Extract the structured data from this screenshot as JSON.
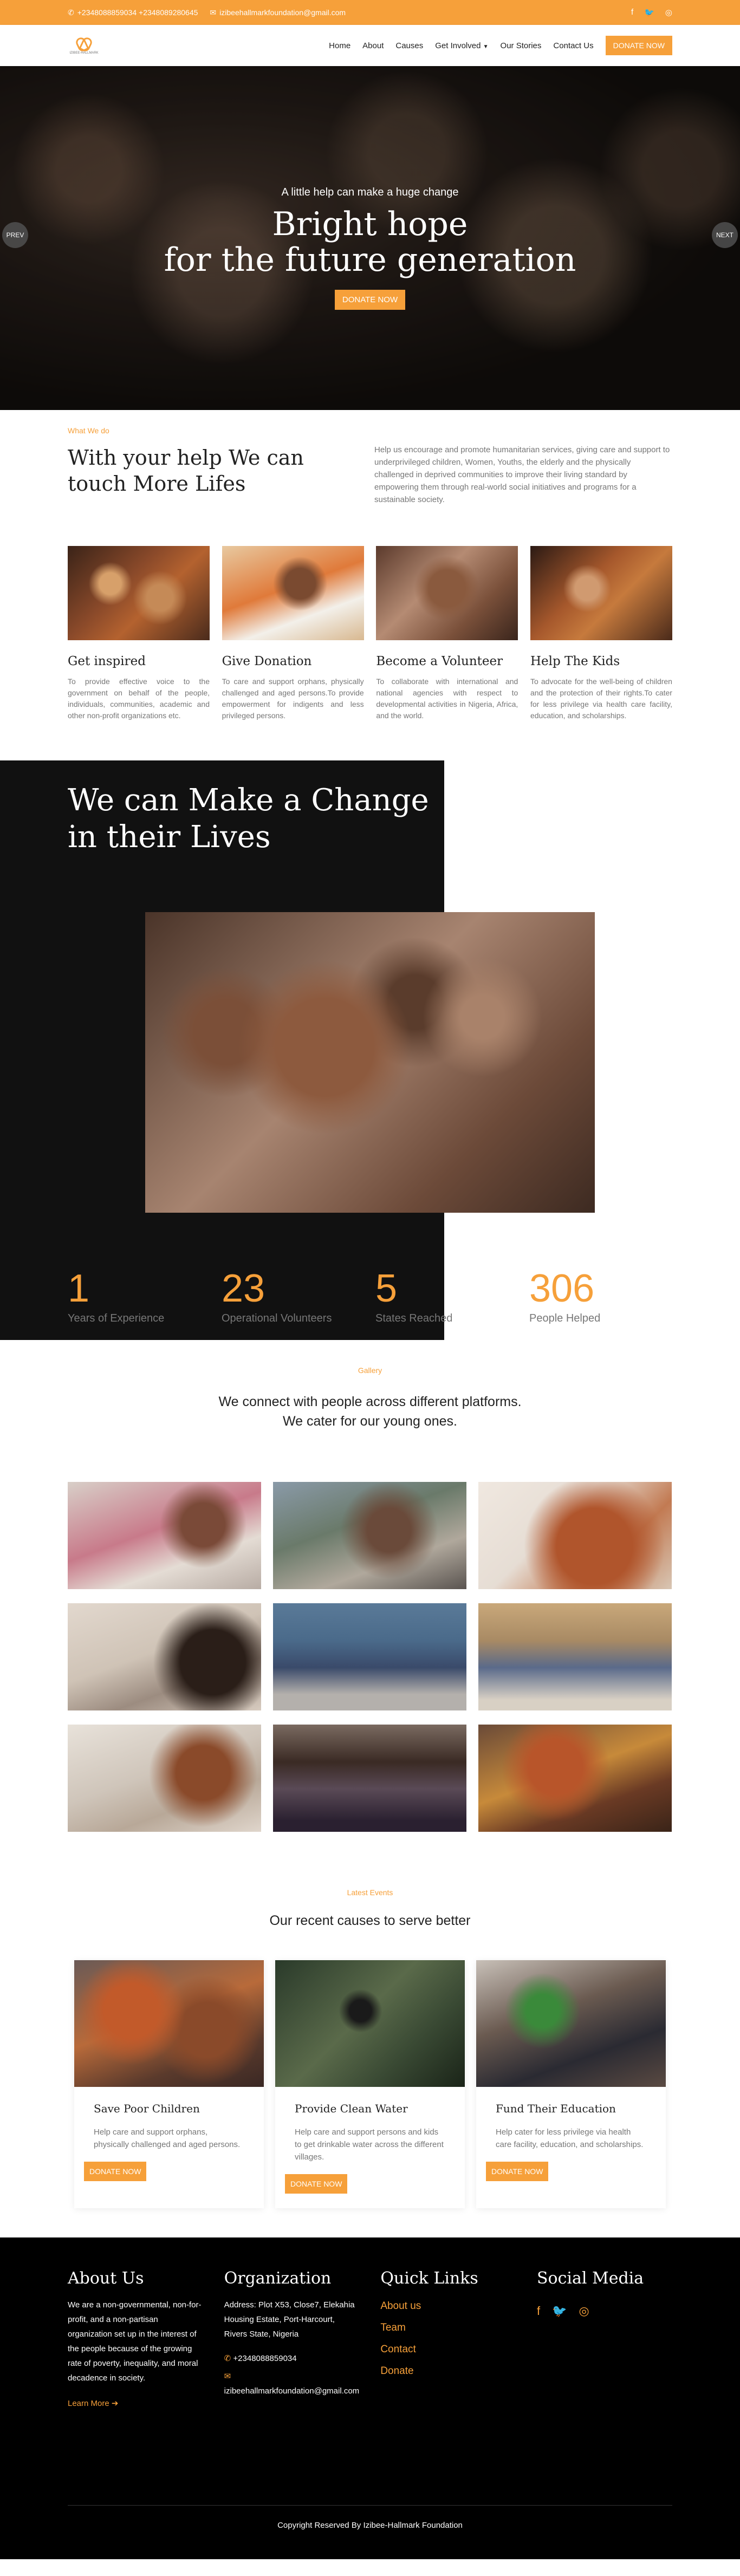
{
  "topbar": {
    "phones": "+2348088859034 +2348089280645",
    "email": "izibeehallmarkfoundation@gmail.com"
  },
  "nav": {
    "logo_text": "IZIBEE-HALLMARK",
    "items": [
      "Home",
      "About",
      "Causes",
      "Get Involved",
      "Our Stories",
      "Contact Us"
    ],
    "donate": "DONATE NOW"
  },
  "hero": {
    "kicker": "A little help can make a huge change",
    "title_line1": "Bright hope",
    "title_line2": "for the future generation",
    "button": "DONATE NOW",
    "prev": "PREV",
    "next": "NEXT"
  },
  "what": {
    "eyebrow": "What We do",
    "title": "With your help We can touch More Lifes",
    "description": "Help us encourage and promote humanitarian services, giving care and support to underprivileged children, Women, Youths, the elderly and the physically challenged in deprived communities to improve their living standard by empowering them through real-world social initiatives and programs for a sustainable society.",
    "cards": [
      {
        "title": "Get inspired",
        "text": "To provide effective voice to the government on behalf of the people, individuals, communities, academic and other non-profit organizations etc."
      },
      {
        "title": "Give Donation",
        "text": "To care and support orphans, physically challenged and aged persons.To provide empowerment for indigents and less privileged persons."
      },
      {
        "title": "Become a Volunteer",
        "text": "To collaborate with international and national agencies with respect to developmental activities in Nigeria, Africa, and the world."
      },
      {
        "title": "Help The Kids",
        "text": "To advocate for the well-being of children and the protection of their rights.To cater for less privilege via health care facility, education, and scholarships."
      }
    ]
  },
  "change": {
    "title_line1": "We can Make a Change",
    "title_line2": "in their Lives",
    "stats": [
      {
        "num": "1",
        "label": "Years of Experience"
      },
      {
        "num": "23",
        "label": "Operational Volunteers"
      },
      {
        "num": "5",
        "label": "States Reached"
      },
      {
        "num": "306",
        "label": "People Helped"
      }
    ]
  },
  "gallery": {
    "eyebrow": "Gallery",
    "line1": "We connect with people across different platforms.",
    "line2": "We cater for our young ones."
  },
  "events": {
    "eyebrow": "Latest Events",
    "subtitle": "Our recent causes to serve better",
    "items": [
      {
        "title": "Save Poor Children",
        "text": "Help care and support orphans, physically challenged and aged persons.",
        "button": "DONATE NOW"
      },
      {
        "title": "Provide Clean Water",
        "text": "Help care and support persons and kids to get drinkable water across the different villages.",
        "button": "DONATE NOW"
      },
      {
        "title": "Fund Their Education",
        "text": "Help cater for less privilege via health care facility, education, and scholarships.",
        "button": "DONATE NOW"
      }
    ]
  },
  "footer": {
    "about_title": "About Us",
    "about_text": "We are a non-governmental, non-for-profit, and a non-partisan organization set up in the interest of the people because of the growing rate of poverty, inequality, and moral decadence in society.",
    "learn_more": "Learn More",
    "org_title": "Organization",
    "address": "Address: Plot X53, Close7, Elekahia Housing Estate, Port-Harcourt, Rivers State, Nigeria",
    "phone": "+2348088859034",
    "email": "izibeehallmarkfoundation@gmail.com",
    "links_title": "Quick Links",
    "links": [
      "About us",
      "Team",
      "Contact",
      "Donate"
    ],
    "social_title": "Social Media",
    "copyright": "Copyright Reserved By Izibee-Hallmark Foundation"
  },
  "colors": {
    "accent": "#f6a03a",
    "dark": "#111111"
  },
  "icons": [
    "phone-icon",
    "mail-icon",
    "facebook-icon",
    "twitter-icon",
    "instagram-icon",
    "chevron-down-icon",
    "arrow-right-icon"
  ]
}
